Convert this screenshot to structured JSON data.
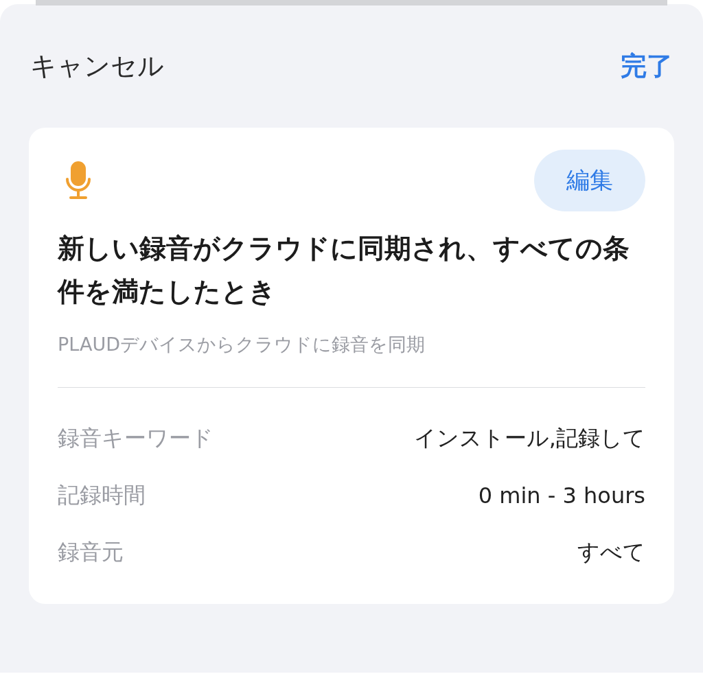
{
  "header": {
    "cancel": "キャンセル",
    "done": "完了"
  },
  "card": {
    "edit_button": "編集",
    "title": "新しい録音がクラウドに同期され、すべての条件を満たしたとき",
    "subtitle": "PLAUDデバイスからクラウドに録音を同期",
    "rows": [
      {
        "label": "録音キーワード",
        "value": "インストール,記録して"
      },
      {
        "label": "記録時間",
        "value": "0 min - 3 hours"
      },
      {
        "label": "録音元",
        "value": "すべて"
      }
    ]
  }
}
